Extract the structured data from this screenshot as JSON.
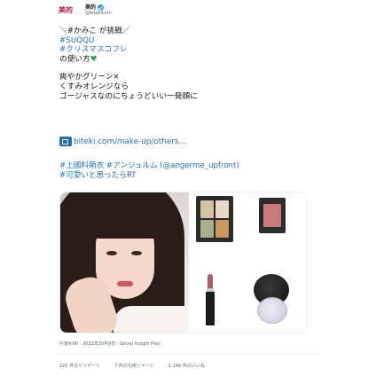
{
  "account": {
    "logo_text": "美的",
    "display_name": "美的",
    "handle": "@bitekicom"
  },
  "tweet": {
    "lines": [
      "＼#かみこ が挑戦／",
      "#SUQQU",
      "#クリスマスコフレ",
      "の使い方"
    ],
    "lines2": [
      "爽やかグリーン×",
      "くすみオレンジなら",
      "ゴージャスなのにちょうどいい一発顔に"
    ],
    "link": "biteki.com/make-up/others…",
    "tags": [
      "#上國料萌衣 #アンジュルム (@angerme_upfront)",
      "#可愛いと思ったらRT"
    ]
  },
  "meta": {
    "timestamp": "午後9:00 · 2022年10月9日 · Social Insight Post"
  },
  "stats": {
    "retweets": "221 件のリツイート",
    "quotes": "7 件の引用ツイート",
    "likes": "1,146 件のいいね"
  },
  "colors": {
    "link": "#1d6fb8",
    "verified": "#1d9bf0",
    "logo": "#c2185b"
  },
  "icons": [
    "verified-badge-icon",
    "heart-icon",
    "link-card-icon"
  ]
}
